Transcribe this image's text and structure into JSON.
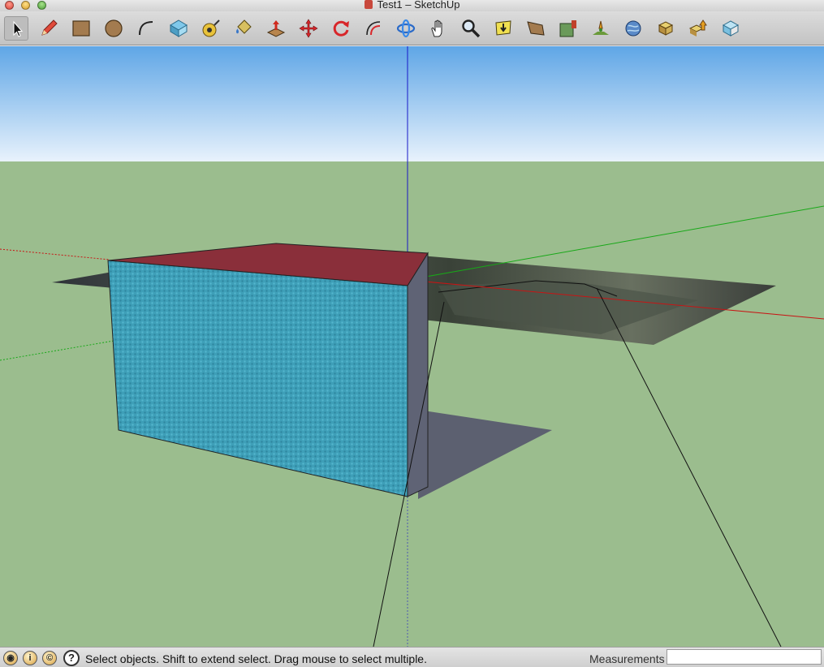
{
  "window": {
    "title": "Test1 – SketchUp"
  },
  "toolbar": {
    "tools": [
      {
        "name": "select-tool",
        "icon": "arrow-icon",
        "selected": true
      },
      {
        "name": "pencil-tool",
        "icon": "pencil-icon"
      },
      {
        "name": "rectangle-tool",
        "icon": "rectangle-icon"
      },
      {
        "name": "circle-tool",
        "icon": "circle-icon"
      },
      {
        "name": "arc-tool",
        "icon": "arc-icon"
      },
      {
        "name": "make-component-tool",
        "icon": "component-icon"
      },
      {
        "name": "tape-measure-tool",
        "icon": "tape-icon"
      },
      {
        "name": "paint-bucket-tool",
        "icon": "bucket-icon"
      },
      {
        "name": "push-pull-tool",
        "icon": "push-pull-icon"
      },
      {
        "name": "move-tool",
        "icon": "move-icon"
      },
      {
        "name": "rotate-tool",
        "icon": "rotate-icon"
      },
      {
        "name": "offset-tool",
        "icon": "offset-icon"
      },
      {
        "name": "orbit-tool",
        "icon": "orbit-icon"
      },
      {
        "name": "pan-tool",
        "icon": "hand-icon"
      },
      {
        "name": "zoom-tool",
        "icon": "magnifier-icon"
      },
      {
        "name": "zoom-extents-tool",
        "icon": "zoom-extents-icon"
      },
      {
        "name": "previous-view-tool",
        "icon": "previous-view-icon"
      },
      {
        "name": "get-current-view-tool",
        "icon": "map-pin-icon"
      },
      {
        "name": "toggle-terrain-tool",
        "icon": "terrain-icon"
      },
      {
        "name": "preview-google-earth-tool",
        "icon": "earth-icon"
      },
      {
        "name": "get-models-tool",
        "icon": "get-models-icon"
      },
      {
        "name": "share-model-tool",
        "icon": "share-model-icon"
      },
      {
        "name": "extension-warehouse-tool",
        "icon": "extension-icon"
      }
    ]
  },
  "colors": {
    "sky_top": "#5fa6e6",
    "sky_bottom": "#e8f2fc",
    "ground": "#9bbd8e",
    "box_front": "#3e9fb8",
    "box_top": "#8a2f3a",
    "box_side": "#5f6375",
    "shadow": "#5c6070",
    "axis_red": "#c81414",
    "axis_green": "#18a818",
    "axis_blue": "#1818c8"
  },
  "statusbar": {
    "icons": [
      "geo-location-icon",
      "credits-icon",
      "copyright-icon"
    ],
    "help_icon": "help-icon",
    "help_glyph": "?",
    "message": "Select objects. Shift to extend select. Drag mouse to select multiple.",
    "measurements_label": "Measurements",
    "measurements_value": ""
  }
}
